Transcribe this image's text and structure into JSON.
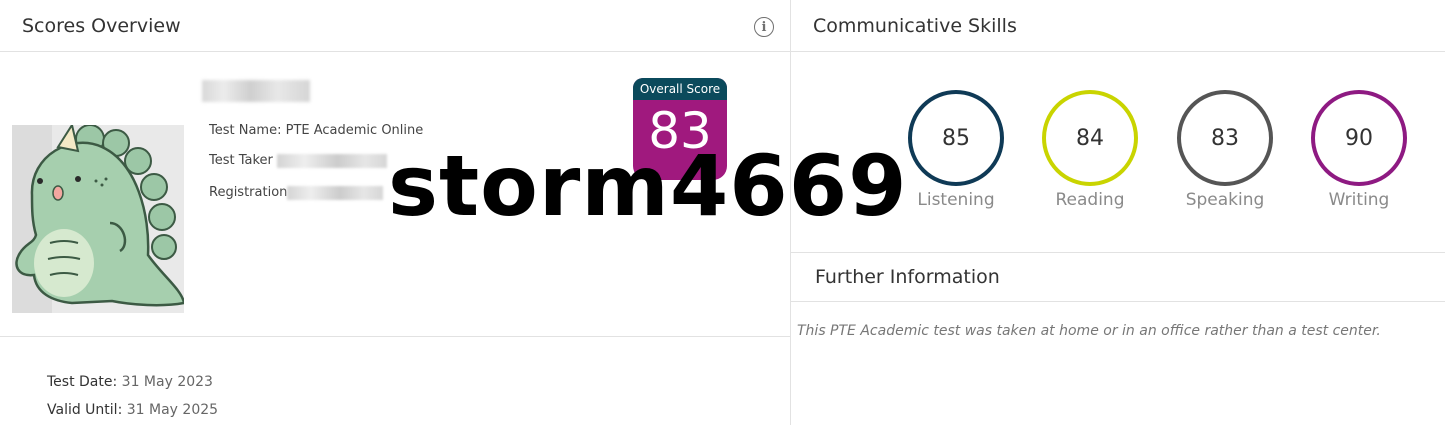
{
  "scores_overview": {
    "title": "Scores Overview",
    "info_icon": "info-icon",
    "test_name_key": "Test Name: ",
    "test_name_value": "PTE Academic Online",
    "test_taker_key": "Test Taker ",
    "registration_key": "Registration",
    "overall": {
      "label": "Overall Score",
      "value": "83",
      "label_color": "#0b4a5c",
      "value_color": "#a0197e"
    },
    "test_date_key": "Test Date:",
    "test_date_value": "31 May 2023",
    "valid_until_key": "Valid Until:",
    "valid_until_value": "31 May 2025"
  },
  "watermark": "storm4669",
  "communicative_skills": {
    "title": "Communicative Skills",
    "skills": [
      {
        "name": "Listening",
        "score": "85",
        "color": "#0f3a56"
      },
      {
        "name": "Reading",
        "score": "84",
        "color": "#c9d400"
      },
      {
        "name": "Speaking",
        "score": "83",
        "color": "#555555"
      },
      {
        "name": "Writing",
        "score": "90",
        "color": "#8e1a82"
      }
    ]
  },
  "further_information": {
    "title": "Further Information",
    "text": "This PTE Academic test was taken at home or in an office rather than a test center."
  }
}
